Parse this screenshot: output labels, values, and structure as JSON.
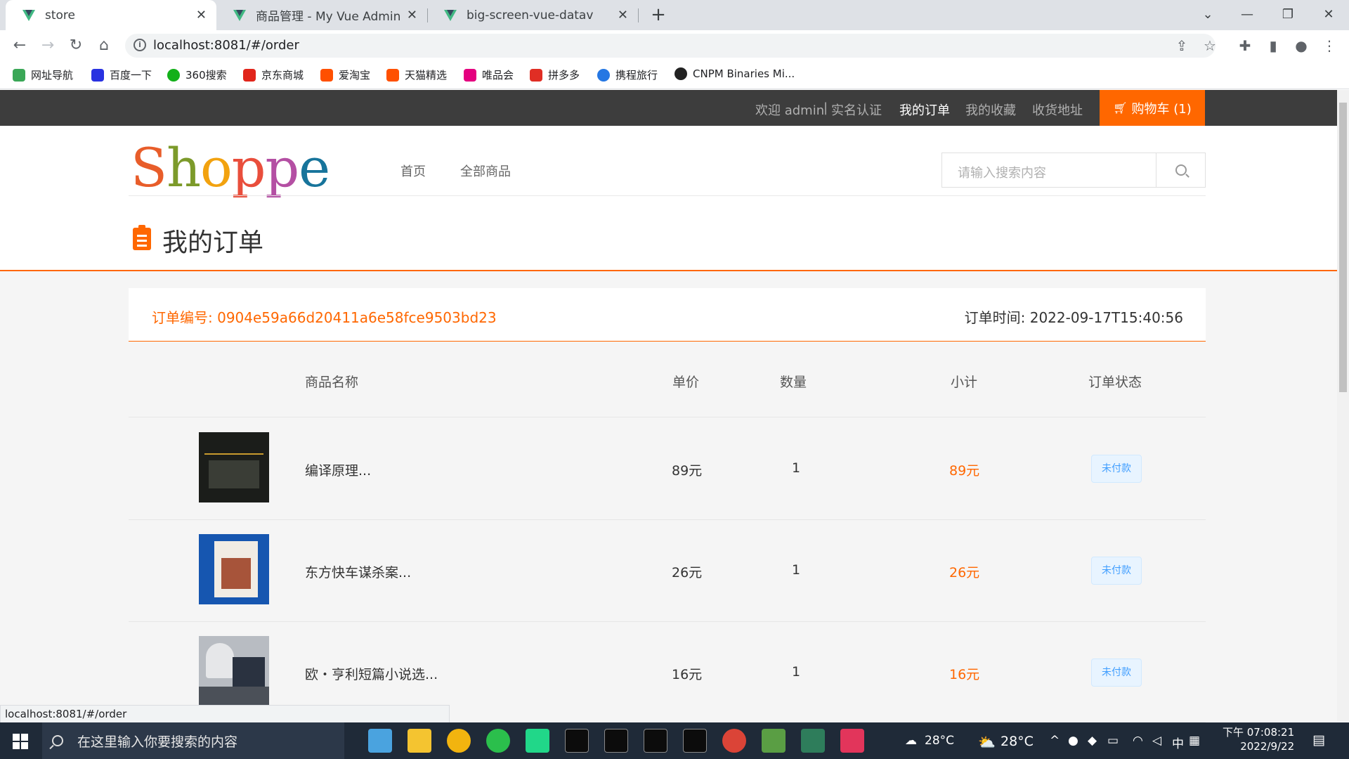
{
  "browser": {
    "tabs": [
      {
        "title": "store",
        "active": true
      },
      {
        "title": "商品管理 - My Vue Admin",
        "active": false
      },
      {
        "title": "big-screen-vue-datav",
        "active": false
      }
    ],
    "url": "localhost:8081/#/order",
    "status_url": "localhost:8081/#/order",
    "bookmarks": [
      {
        "label": "网址导航",
        "color": "#3aa757"
      },
      {
        "label": "百度一下",
        "color": "#2932e1"
      },
      {
        "label": "360搜索",
        "color": "#13b01a"
      },
      {
        "label": "京东商城",
        "color": "#e1251b"
      },
      {
        "label": "爱淘宝",
        "color": "#ff5000"
      },
      {
        "label": "天猫精选",
        "color": "#ff5000"
      },
      {
        "label": "唯品会",
        "color": "#e4007f"
      },
      {
        "label": "拼多多",
        "color": "#e02e24"
      },
      {
        "label": "携程旅行",
        "color": "#2577e3"
      },
      {
        "label": "CNPM Binaries Mi...",
        "color": "#222222"
      }
    ]
  },
  "site": {
    "topbar": {
      "welcome": "欢迎 admin",
      "divider": "|",
      "verify": "实名认证",
      "orders": "我的订单",
      "favorites": "我的收藏",
      "address": "收货地址",
      "cart": "购物车 (1)"
    },
    "logo_letters": [
      {
        "ch": "S",
        "color": "#e85d2a"
      },
      {
        "ch": "h",
        "color": "#7c9a2a"
      },
      {
        "ch": "o",
        "color": "#f2a20f"
      },
      {
        "ch": "p",
        "color": "#e94e3c"
      },
      {
        "ch": "p",
        "color": "#b44fa3"
      },
      {
        "ch": "e",
        "color": "#17749b"
      }
    ],
    "nav": {
      "home": "首页",
      "all": "全部商品"
    },
    "search_placeholder": "请输入搜索内容",
    "page_title": "我的订单",
    "accent": "#ff6700"
  },
  "order": {
    "number_label": "订单编号: 0904e59a66d20411a6e58fce9503bd23",
    "time_label": "订单时间: 2022-09-17T15:40:56",
    "columns": {
      "name": "商品名称",
      "price": "单价",
      "qty": "数量",
      "subtotal": "小计",
      "status": "订单状态"
    },
    "items": [
      {
        "name": "编译原理...",
        "price": "89元",
        "qty": "1",
        "subtotal": "89元",
        "status": "未付款",
        "cover": "#1b1d1a"
      },
      {
        "name": "东方快车谋杀案...",
        "price": "26元",
        "qty": "1",
        "subtotal": "26元",
        "status": "未付款",
        "cover": "#1656b0"
      },
      {
        "name": "欧・亨利短篇小说选...",
        "price": "16元",
        "qty": "1",
        "subtotal": "16元",
        "status": "未付款",
        "cover": "#8a8f96"
      }
    ]
  },
  "taskbar": {
    "search_placeholder": "在这里输入你要搜索的内容",
    "weather1": "28°C",
    "weather2": "28°C",
    "ime": "中",
    "time": "下午 07:08:21",
    "date": "2022/9/22"
  }
}
